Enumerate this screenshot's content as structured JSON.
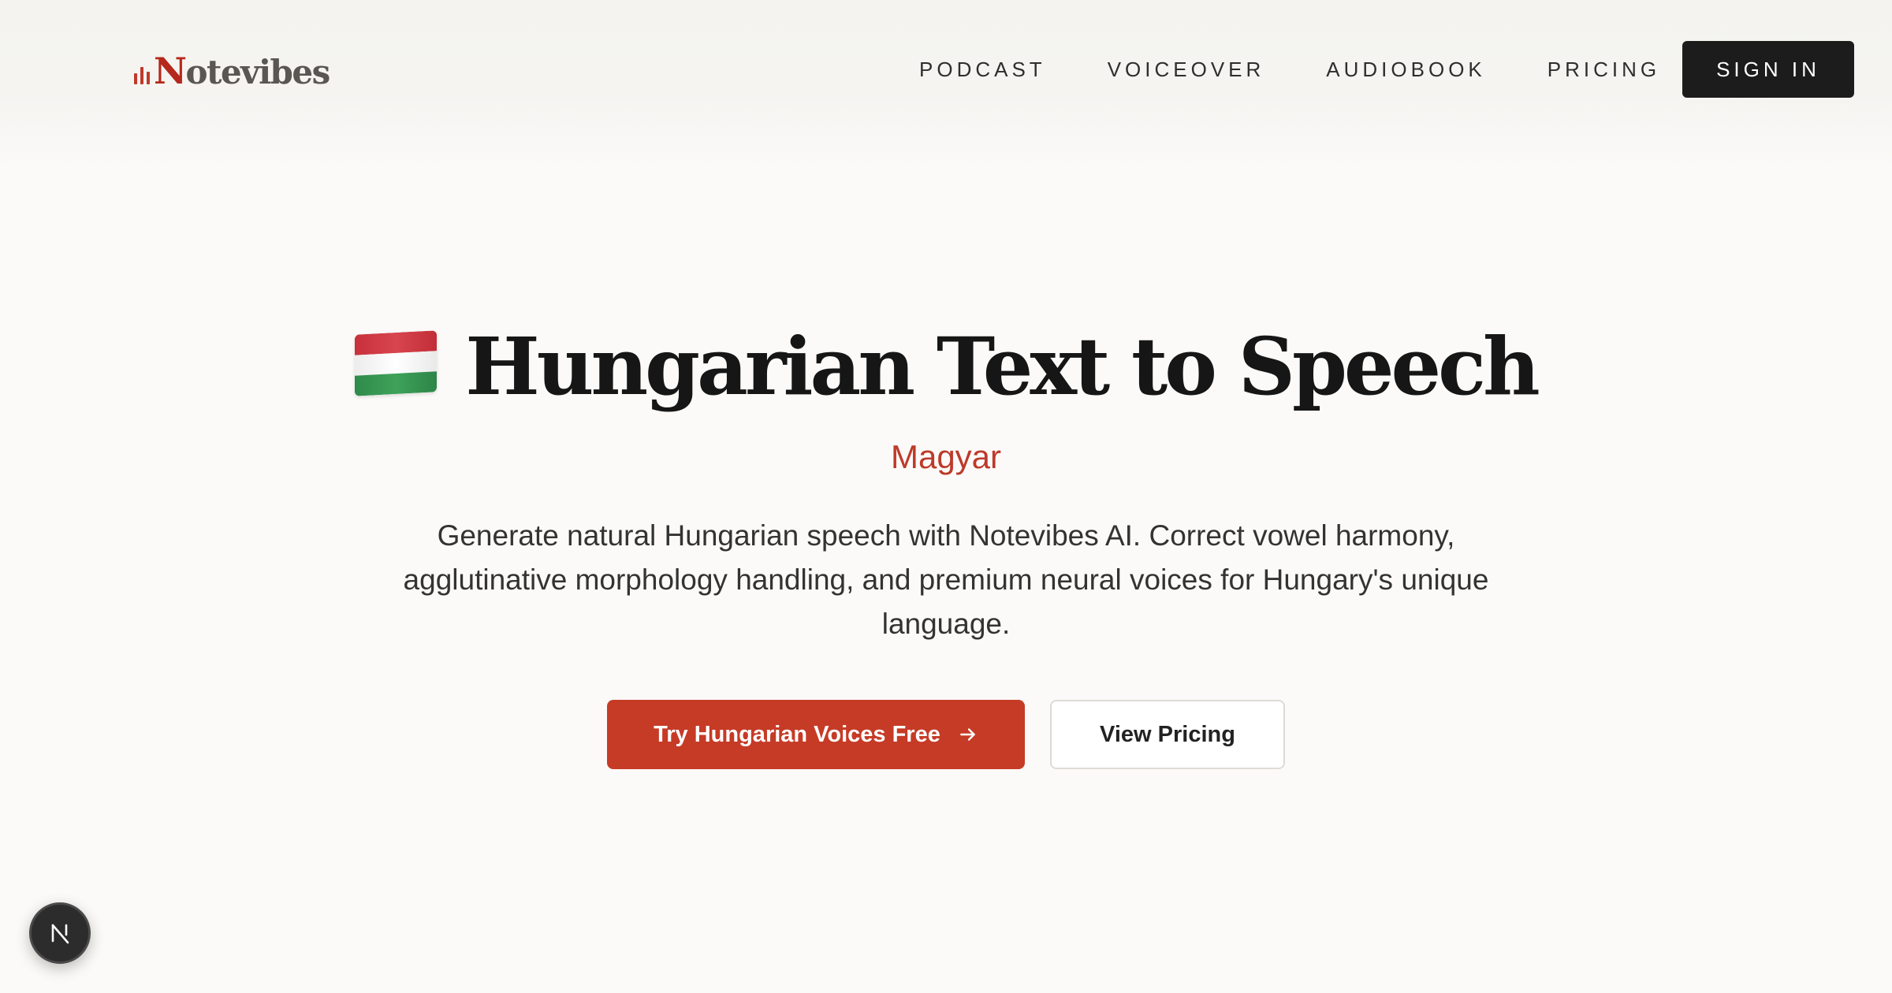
{
  "brand": {
    "name_first": "N",
    "name_rest": "otevibes",
    "accent_color": "#c63b26"
  },
  "nav": {
    "items": [
      "PODCAST",
      "VOICEOVER",
      "AUDIOBOOK",
      "PRICING"
    ],
    "sign_in": "SIGN IN"
  },
  "hero": {
    "flag_icon": "hungary-flag-icon",
    "title": "Hungarian Text to Speech",
    "subtitle": "Magyar",
    "description": "Generate natural Hungarian speech with Notevibes AI. Correct vowel harmony, agglutinative morphology handling, and premium neural voices for Hungary's unique language.",
    "primary_cta": "Try Hungarian Voices Free",
    "secondary_cta": "View Pricing"
  },
  "dev_badge": {
    "icon": "nextjs-icon"
  }
}
